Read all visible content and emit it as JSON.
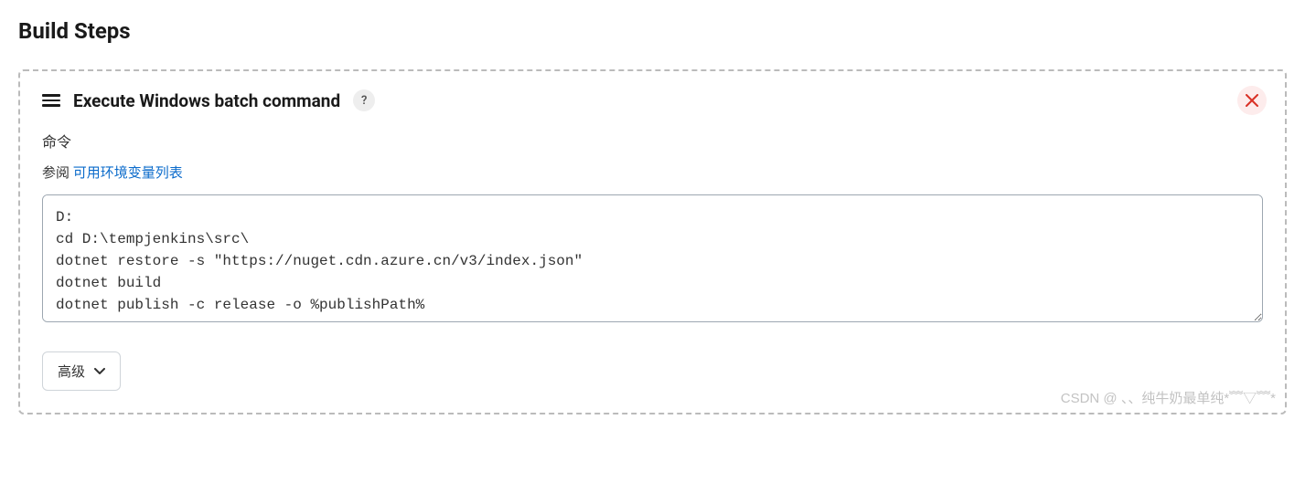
{
  "page": {
    "title": "Build Steps"
  },
  "step": {
    "title": "Execute Windows batch command",
    "help_symbol": "?",
    "field_label": "命令",
    "hint_prefix": "参阅 ",
    "hint_link_text": "可用环境变量列表",
    "command_value": "D:\ncd D:\\tempjenkins\\src\\\ndotnet restore -s \"https://nuget.cdn.azure.cn/v3/index.json\"\ndotnet build\ndotnet publish -c release -o %publishPath%",
    "advanced_label": "高级"
  },
  "watermark": "CSDN @ 、、纯牛奶最单纯*﹌▽﹌*"
}
